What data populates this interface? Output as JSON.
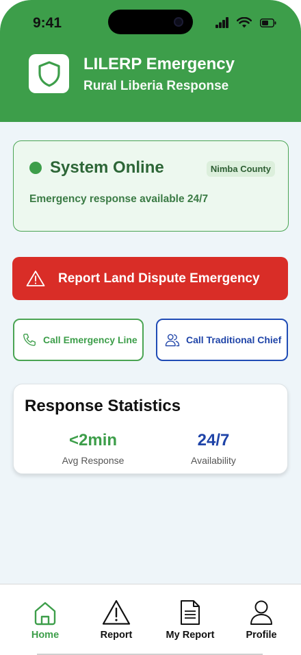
{
  "status_bar": {
    "time": "9:41"
  },
  "header": {
    "title": "LILERP Emergency",
    "subtitle": "Rural Liberia Response",
    "logo_icon": "shield-icon"
  },
  "system_status": {
    "title": "System Online",
    "county": "Nimba County",
    "description": "Emergency response available 24/7"
  },
  "emergency_button": {
    "label": "Report Land Dispute Emergency",
    "icon": "warning-triangle-icon"
  },
  "call_buttons": {
    "emergency_line": {
      "label": "Call Emergency Line",
      "icon": "phone-icon"
    },
    "traditional_chief": {
      "label": "Call Traditional Chief",
      "icon": "users-icon"
    }
  },
  "stats": {
    "title": "Response Statistics",
    "items": [
      {
        "value": "<2min",
        "label": "Avg Response"
      },
      {
        "value": "24/7",
        "label": "Availability"
      }
    ]
  },
  "nav": {
    "items": [
      {
        "label": "Home",
        "icon": "home-icon",
        "active": true
      },
      {
        "label": "Report",
        "icon": "warning-triangle-icon",
        "active": false
      },
      {
        "label": "My Report",
        "icon": "document-icon",
        "active": false
      },
      {
        "label": "Profile",
        "icon": "user-icon",
        "active": false
      }
    ]
  },
  "colors": {
    "primary_green": "#3d9e4a",
    "emergency_red": "#d92d27",
    "chief_blue": "#1f44a8",
    "background": "#eef5f9"
  }
}
